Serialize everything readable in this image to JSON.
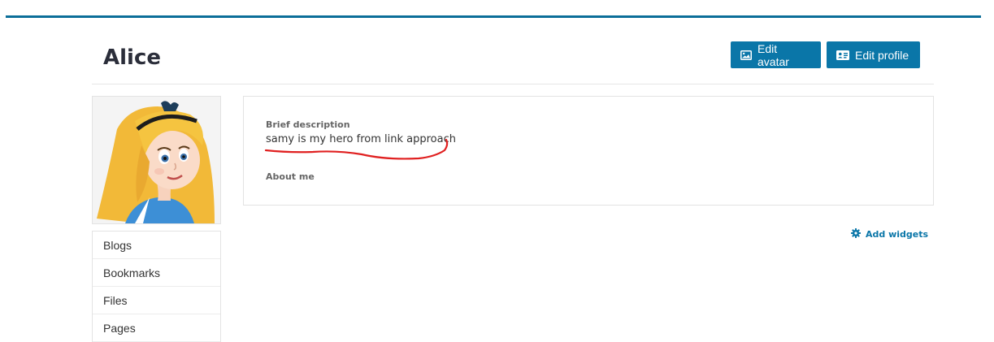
{
  "profile": {
    "name": "Alice",
    "edit_avatar_label": "Edit avatar",
    "edit_profile_label": "Edit profile"
  },
  "sidebar": {
    "items": [
      {
        "label": "Blogs"
      },
      {
        "label": "Bookmarks"
      },
      {
        "label": "Files"
      },
      {
        "label": "Pages"
      }
    ]
  },
  "details": {
    "brief_label": "Brief description",
    "brief_value": "samy is my hero from link approach",
    "about_label": "About me"
  },
  "widgets": {
    "add_label": "Add widgets"
  },
  "colors": {
    "accent": "#0a76a8",
    "topbar": "#0b6e99",
    "annotation": "#e02020"
  }
}
